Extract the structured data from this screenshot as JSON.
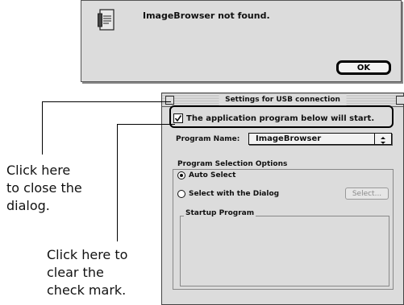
{
  "alert": {
    "message": "ImageBrowser not found.",
    "ok_label": "OK"
  },
  "settings_window": {
    "title": "Settings for USB connection",
    "checkbox_label": "The application program below will start.",
    "checkbox_checked": true,
    "program_name_label": "Program Name:",
    "program_name_value": "ImageBrowser",
    "selection_group_label": "Program Selection Options",
    "options": [
      {
        "label": "Auto Select",
        "selected": true
      },
      {
        "label": "Select with the Dialog",
        "selected": false
      }
    ],
    "select_button_label": "Select...",
    "startup_group_label": "Startup Program"
  },
  "callouts": {
    "close_dialog": "Click here\nto close the\ndialog.",
    "clear_check": "Click here to\nclear the\ncheck mark."
  }
}
